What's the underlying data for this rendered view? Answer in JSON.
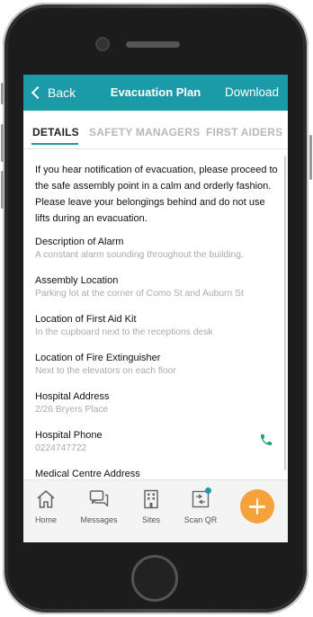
{
  "header": {
    "back_label": "Back",
    "title": "Evacuation Plan",
    "download_label": "Download",
    "color": "#1b9aa8"
  },
  "tabs": [
    {
      "label": "DETAILS",
      "active": true
    },
    {
      "label": "SAFETY MANAGERS",
      "active": false
    },
    {
      "label": "FIRST AIDERS",
      "active": false
    }
  ],
  "intro": "If you hear notification of evacuation, please proceed to the safe assembly point in a calm and orderly fashion. Please leave your belongings behind and do not use lifts during an evacuation.",
  "details": [
    {
      "label": "Description of Alarm",
      "value": "A constant alarm sounding throughout the building."
    },
    {
      "label": "Assembly Location",
      "value": "Parking lot at the corner of Como St and Auburn St"
    },
    {
      "label": "Location of First Aid Kit",
      "value": "In the cupboard next to the receptions desk"
    },
    {
      "label": "Location of Fire Extinguisher",
      "value": "Next to the elevators on each floor"
    },
    {
      "label": "Hospital Address",
      "value": "2/26 Bryers Place"
    },
    {
      "label": "Hospital Phone",
      "value": "0224747722"
    },
    {
      "label": "Medical Centre Address",
      "value": ""
    }
  ],
  "bottom_nav": [
    {
      "label": "Home",
      "icon": "home-icon"
    },
    {
      "label": "Messages",
      "icon": "messages-icon"
    },
    {
      "label": "Sites",
      "icon": "building-icon"
    },
    {
      "label": "Scan QR",
      "icon": "scan-qr-icon"
    }
  ],
  "fab_icon": "plus-icon",
  "fab_color": "#f5a23a"
}
